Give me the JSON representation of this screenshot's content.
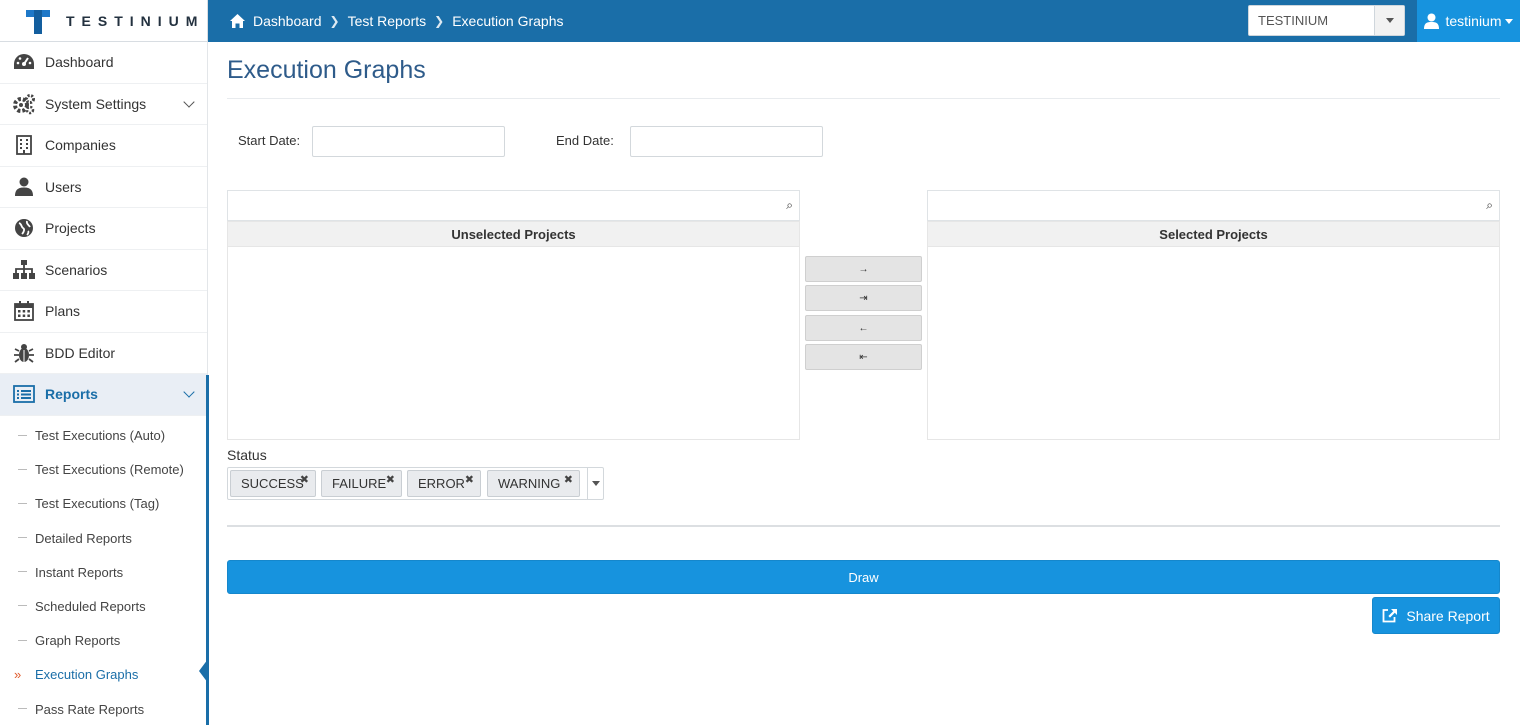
{
  "brand": {
    "name": "TESTINIUM"
  },
  "breadcrumb": {
    "items": [
      "Dashboard",
      "Test Reports",
      "Execution Graphs"
    ]
  },
  "company_select": {
    "value": "TESTINIUM"
  },
  "user": {
    "name": "testinium"
  },
  "sidebar": {
    "items": [
      {
        "label": "Dashboard",
        "icon": "dashboard-gauge-icon"
      },
      {
        "label": "System Settings",
        "icon": "gears-icon",
        "expandable": true
      },
      {
        "label": "Companies",
        "icon": "building-icon"
      },
      {
        "label": "Users",
        "icon": "user-icon"
      },
      {
        "label": "Projects",
        "icon": "globe-icon"
      },
      {
        "label": "Scenarios",
        "icon": "sitemap-icon"
      },
      {
        "label": "Plans",
        "icon": "calendar-icon"
      },
      {
        "label": "BDD Editor",
        "icon": "bug-icon"
      },
      {
        "label": "Reports",
        "icon": "list-icon",
        "expandable": true,
        "active": true
      }
    ],
    "reports_sub": [
      "Test Executions (Auto)",
      "Test Executions (Remote)",
      "Test Executions (Tag)",
      "Detailed Reports",
      "Instant Reports",
      "Scheduled Reports",
      "Graph Reports",
      "Execution Graphs",
      "Pass Rate Reports"
    ],
    "current_sub_marker": "»"
  },
  "page": {
    "title": "Execution Graphs",
    "start_date_label": "Start Date:",
    "start_date_value": "",
    "end_date_label": "End Date:",
    "end_date_value": "",
    "unselected_title": "Unselected Projects",
    "selected_title": "Selected Projects",
    "move_buttons": [
      "→",
      "⇥",
      "←",
      "⇤"
    ],
    "status_label": "Status",
    "status_tags": [
      "SUCCESS",
      "FAILURE",
      "ERROR",
      "WARNING"
    ],
    "tag_remove_glyph": "✖",
    "search_glyph": "⌕",
    "draw_label": "Draw",
    "share_label": "Share Report"
  },
  "colors": {
    "header": "#1a6ea8",
    "accent": "#1793de",
    "active_marker": "#e05a2b"
  }
}
